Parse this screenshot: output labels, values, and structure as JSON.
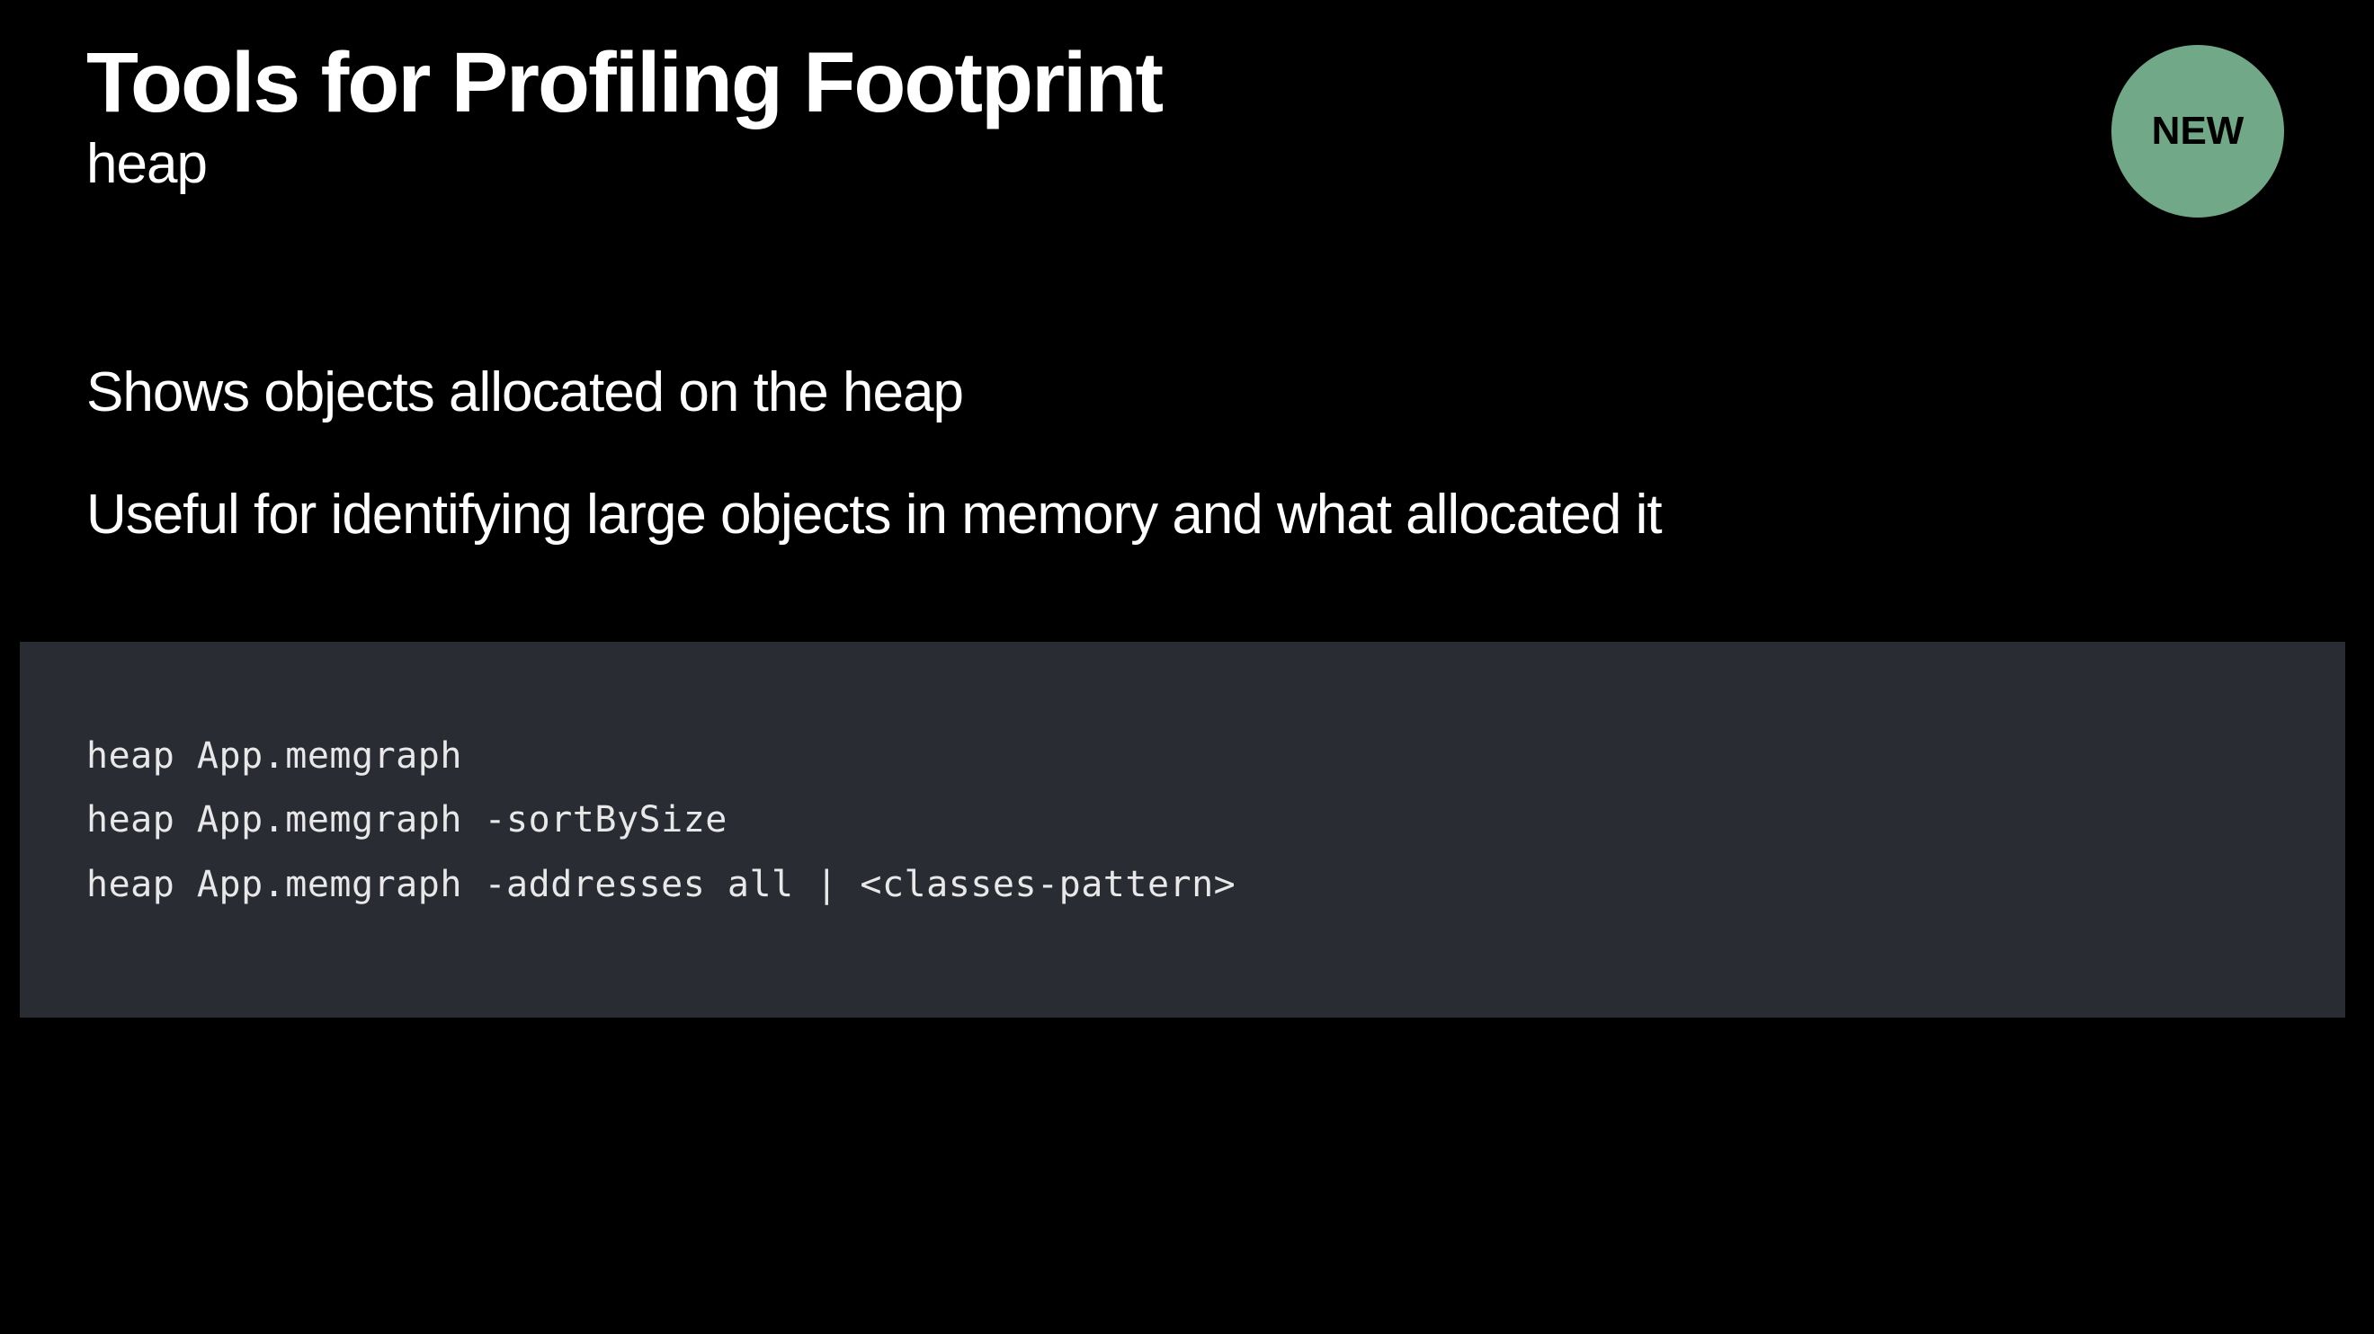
{
  "slide": {
    "title": "Tools for Profiling Footprint",
    "subtitle": "heap",
    "badge": "NEW",
    "bullets": [
      "Shows objects allocated on the heap",
      "Useful for identifying large objects in memory and what allocated it"
    ],
    "code_lines": [
      "heap App.memgraph",
      "heap App.memgraph -sortBySize",
      "heap App.memgraph -addresses all | <classes-pattern>"
    ]
  }
}
